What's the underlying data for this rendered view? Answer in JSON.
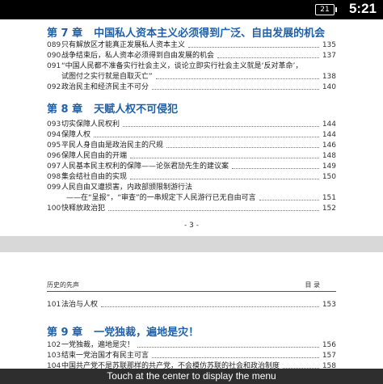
{
  "status_bar": {
    "battery": "21",
    "time": "5:21"
  },
  "page1": {
    "chapter7": {
      "num": "第 7 章",
      "title": "中国私人资本主义必须得到广泛、自由发展的机会",
      "entries": [
        {
          "n": "089",
          "t": "只有解放区才能真正发展私人资本主义",
          "p": "135"
        },
        {
          "n": "090",
          "t": "战争结束后，私人资本必须得到自由发展的机会",
          "p": "137"
        },
        {
          "n": "091",
          "t": "“中国人民都不准备实行社会主义，谈论立即实行社会主义就是‘反对革命’，",
          "p": ""
        },
        {
          "n": "",
          "t": "试图付之实行就是自取灭亡”",
          "p": "138"
        },
        {
          "n": "092",
          "t": "政治民主和经济民主不可分",
          "p": "140"
        }
      ]
    },
    "chapter8": {
      "num": "第 8 章",
      "title": "天赋人权不可侵犯",
      "entries": [
        {
          "n": "093",
          "t": "切实保障人民权利",
          "p": "144"
        },
        {
          "n": "094",
          "t": "保障人权",
          "p": "144"
        },
        {
          "n": "095",
          "t": "平民人身自由是政治民主的尺规",
          "p": "146"
        },
        {
          "n": "096",
          "t": "保障人民自由的开端",
          "p": "148"
        },
        {
          "n": "097",
          "t": "人民基本民主权利的保障——论张君劢先生的建议案",
          "p": "149"
        },
        {
          "n": "098",
          "t": "集会结社自由的实现",
          "p": "150"
        },
        {
          "n": "099",
          "t": "人民自由又遭损害，内政部颁限制游行法",
          "p": ""
        },
        {
          "n": "",
          "t": "——在“呈报”，“审查”的一串规定下人民游行已无自由可言",
          "p": "151"
        },
        {
          "n": "100",
          "t": "快释放政治犯",
          "p": "152"
        }
      ]
    },
    "page_number": "- 3 -"
  },
  "page2": {
    "running_head_left": "历史的先声",
    "running_head_right": "目    录",
    "entry101": {
      "n": "101",
      "t": "法治与人权",
      "p": "153"
    },
    "chapter9": {
      "num": "第 9 章",
      "title": "一党独裁，遍地是灾！",
      "entries": [
        {
          "n": "102",
          "t": "一党独裁，遍地是灾！",
          "p": "156"
        },
        {
          "n": "103",
          "t": "结束一党治国才有民主可言",
          "p": "157"
        },
        {
          "n": "104",
          "t": "中国共产党不是苏联那样的共产党，不会模仿苏联的社会和政治制度",
          "p": "158"
        }
      ]
    }
  },
  "overlay_hint": "Touch at the center to display the menu",
  "colors": {
    "chapter": "#2060a8",
    "background": "#ffffff",
    "status_bar": "#000000"
  }
}
